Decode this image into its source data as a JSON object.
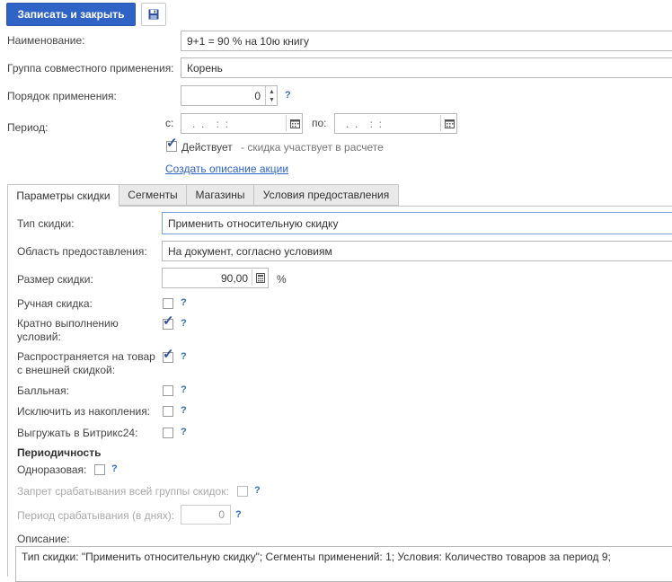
{
  "toolbar": {
    "save_close_label": "Записать и закрыть",
    "save_icon": "floppy-disk-icon"
  },
  "form": {
    "name_label": "Наименование:",
    "name_value": "9+1 = 90 % на 10ю книгу",
    "group_label": "Группа совместного применения:",
    "group_value": "Корень",
    "order_label": "Порядок применения:",
    "order_value": "0",
    "period_label": "Период:",
    "period_from_label": "с:",
    "period_from_value": ".  .    :  :",
    "period_to_label": "по:",
    "period_to_value": ".  .    :  :",
    "active_label": "Действует",
    "active_note": "- скидка участвует в расчете",
    "active_checked": true,
    "create_link": "Создать описание акции"
  },
  "tabs": [
    {
      "label": "Параметры скидки",
      "active": true
    },
    {
      "label": "Сегменты",
      "active": false
    },
    {
      "label": "Магазины",
      "active": false
    },
    {
      "label": "Условия предоставления",
      "active": false
    }
  ],
  "params": {
    "type_label": "Тип скидки:",
    "type_value": "Применить относительную скидку",
    "area_label": "Область предоставления:",
    "area_value": "На документ, согласно условиям",
    "size_label": "Размер скидки:",
    "size_value": "90,00",
    "size_unit": "%",
    "manual_label": "Ручная скидка:",
    "multiple_label_1": "Кратно выполнению",
    "multiple_label_2": "условий:",
    "external_label_1": "Распространяется на товар",
    "external_label_2": "с внешней скидкой:",
    "points_label": "Балльная:",
    "exclude_label": "Исключить из накопления:",
    "bitrix_label": "Выгружать в Битрикс24:",
    "periodicity_header": "Периодичность",
    "onetime_label": "Одноразовая:",
    "group_ban_label": "Запрет срабатывания всей группы скидок:",
    "trigger_period_label": "Период срабатывания (в днях):",
    "trigger_period_value": "0",
    "description_label": "Описание:",
    "description_value": "Тип скидки: \"Применить относительную скидку\"; Сегменты применений: 1; Условия: Количество товаров за период 9;",
    "help_mark": "?"
  }
}
